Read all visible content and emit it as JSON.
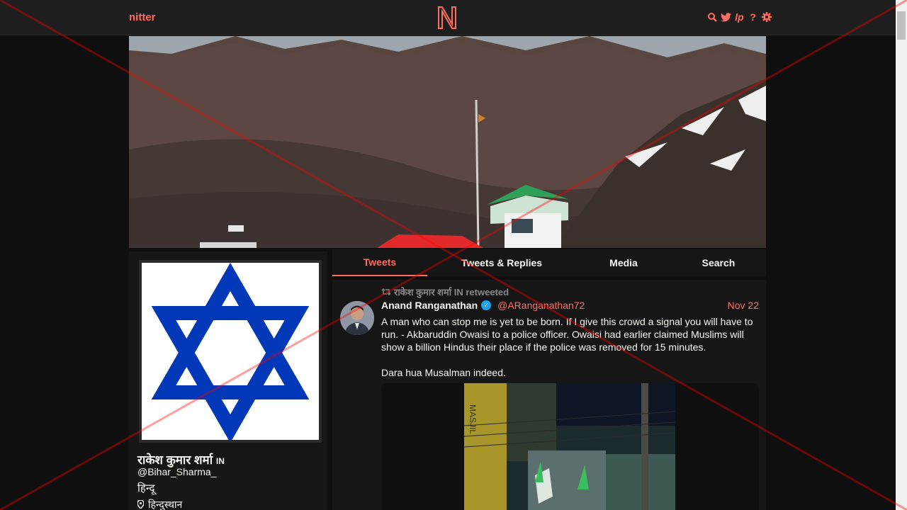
{
  "nav": {
    "brand": "nitter",
    "logo_letter": "N",
    "icons": [
      "search-icon",
      "twitter-icon",
      "rss-icon",
      "help-icon",
      "settings-icon"
    ]
  },
  "profile": {
    "fullname": "राकेश कुमार शर्मा",
    "flag": "IN",
    "username": "@Bihar_Sharma_",
    "bio": "हिन्दू",
    "location": "हिन्दुस्थान",
    "avatar": "star-of-david-icon"
  },
  "tabs": [
    {
      "label": "Tweets",
      "active": true
    },
    {
      "label": "Tweets & Replies",
      "active": false
    },
    {
      "label": "Media",
      "active": false
    },
    {
      "label": "Search",
      "active": false
    }
  ],
  "tweet": {
    "retweet_header": "राकेश कुमार शर्मा IN retweeted",
    "author_name": "Anand Ranganathan",
    "author_handle": "@ARanganathan72",
    "date": "Nov 22",
    "text": "A man who can stop me is yet to be born. If I give this crowd a signal you will have to run. - Akbaruddin Owaisi to a police officer. Owaisi had earlier claimed Muslims will show a billion Hindus their place if the police was removed for 15 minutes.\n\nDara hua Musalman indeed."
  },
  "colors": {
    "accent": "#ff6c60",
    "background": "#0f0f0f",
    "panel": "#161616",
    "star": "#0038b8"
  }
}
